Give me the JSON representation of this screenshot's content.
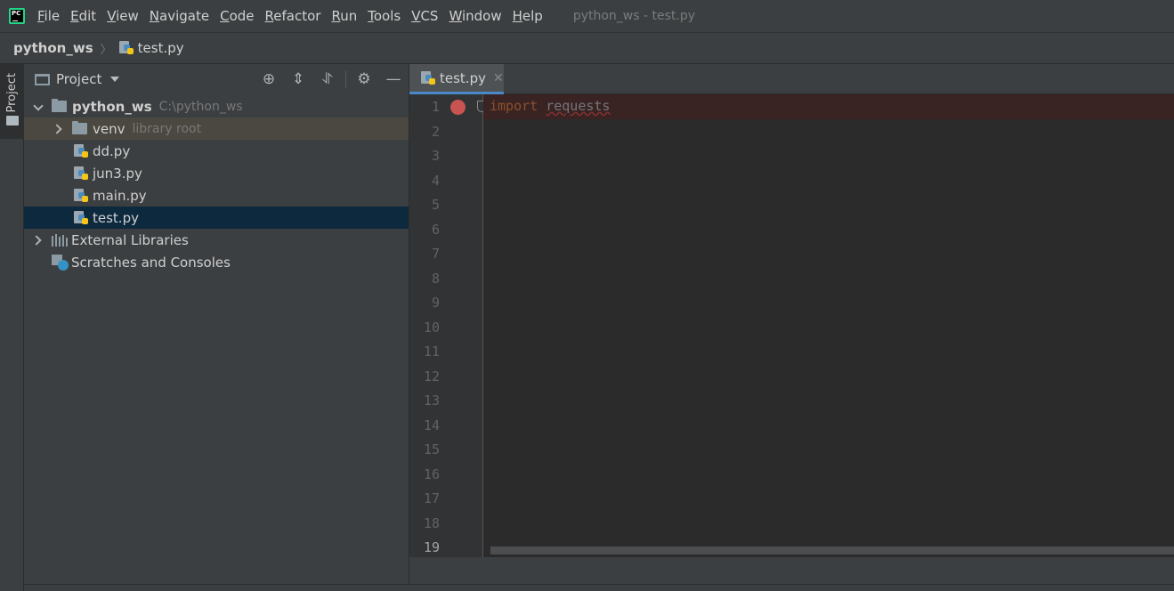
{
  "menubar": {
    "items": [
      "File",
      "Edit",
      "View",
      "Navigate",
      "Code",
      "Refactor",
      "Run",
      "Tools",
      "VCS",
      "Window",
      "Help"
    ],
    "window_title": "python_ws - test.py"
  },
  "navbar": {
    "root": "python_ws",
    "file": "test.py"
  },
  "left_stripe": {
    "tab_label": "Project"
  },
  "project_panel": {
    "title": "Project",
    "tree": {
      "root": {
        "name": "python_ws",
        "path": "C:\\python_ws"
      },
      "venv": {
        "name": "venv",
        "note": "library root"
      },
      "files": [
        "dd.py",
        "jun3.py",
        "main.py",
        "test.py"
      ],
      "external": "External Libraries",
      "scratches": "Scratches and Consoles"
    }
  },
  "editor": {
    "tab_label": "test.py",
    "code": {
      "keyword": "import",
      "module": "requests"
    },
    "line_numbers": [
      "1",
      "2",
      "3",
      "4",
      "5",
      "6",
      "7",
      "8",
      "9",
      "10",
      "11",
      "12",
      "13",
      "14",
      "15",
      "16",
      "17",
      "18",
      "19"
    ]
  },
  "colors": {
    "background": "#3c3f41",
    "editor_bg": "#2b2b2b",
    "selection": "#0d293e",
    "breakpoint": "#c75450",
    "keyword": "#cc7832"
  }
}
